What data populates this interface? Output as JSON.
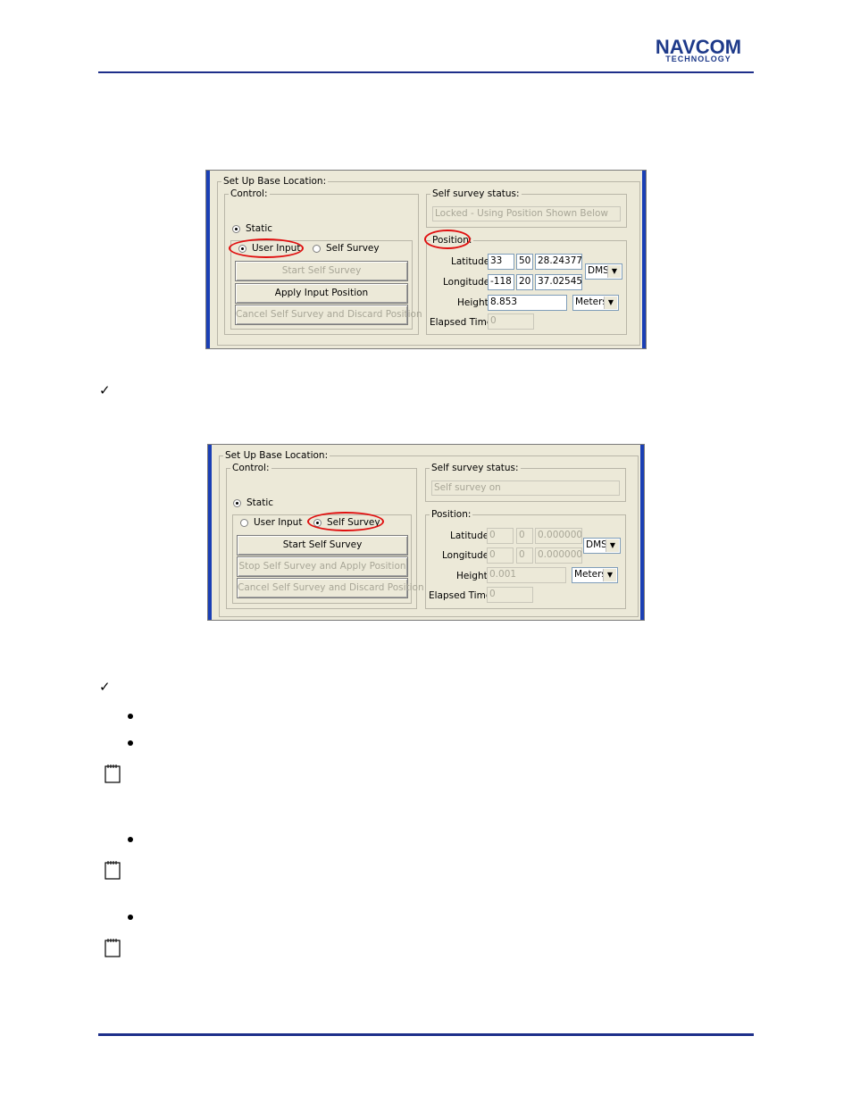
{
  "header": {
    "logo_main": "NAVCOM",
    "logo_sub": "TECHNOLOGY"
  },
  "colors": {
    "accent": "#1e2f8a",
    "highlight": "#e01010",
    "dialog_bg": "#ece9d8"
  },
  "panel1": {
    "group_title": "Set Up Base Location:",
    "control_title": "Control:",
    "static_label": "Static",
    "user_input_label": "User Input",
    "self_survey_label": "Self Survey",
    "start_btn": "Start Self Survey",
    "apply_btn": "Apply Input Position",
    "cancel_btn": "Cancel Self Survey and Discard Position",
    "status_title": "Self survey status:",
    "status_value": "Locked - Using Position Shown Below",
    "position_title": "Position:",
    "latitude_label": "Latitude:",
    "lat_deg": "33",
    "lat_min": "50",
    "lat_sec": "28.243774",
    "longitude_label": "Longitude:",
    "lon_deg": "-118",
    "lon_min": "20",
    "lon_sec": "37.025451",
    "format": "DMS",
    "height_label": "Height:",
    "height_value": "8.853",
    "units": "Meters",
    "elapsed_label": "Elapsed Time:",
    "elapsed_value": "0"
  },
  "panel2": {
    "group_title": "Set Up Base Location:",
    "control_title": "Control:",
    "static_label": "Static",
    "user_input_label": "User Input",
    "self_survey_label": "Self Survey",
    "start_btn": "Start Self Survey",
    "stop_btn": "Stop Self Survey and Apply Position",
    "cancel_btn": "Cancel Self Survey and Discard Position",
    "status_title": "Self survey status:",
    "status_value": "Self survey on",
    "position_title": "Position:",
    "latitude_label": "Latitude:",
    "lat_deg": "0",
    "lat_min": "0",
    "lat_sec": "0.000000",
    "longitude_label": "Longitude:",
    "lon_deg": "0",
    "lon_min": "0",
    "lon_sec": "0.000000",
    "format": "DMS",
    "height_label": "Height:",
    "height_value": "0.001",
    "units": "Meters",
    "elapsed_label": "Elapsed Time:",
    "elapsed_value": "0"
  },
  "icons": {
    "check": "checkmark-icon",
    "note": "notepad-icon",
    "bullet": "bullet-icon"
  }
}
